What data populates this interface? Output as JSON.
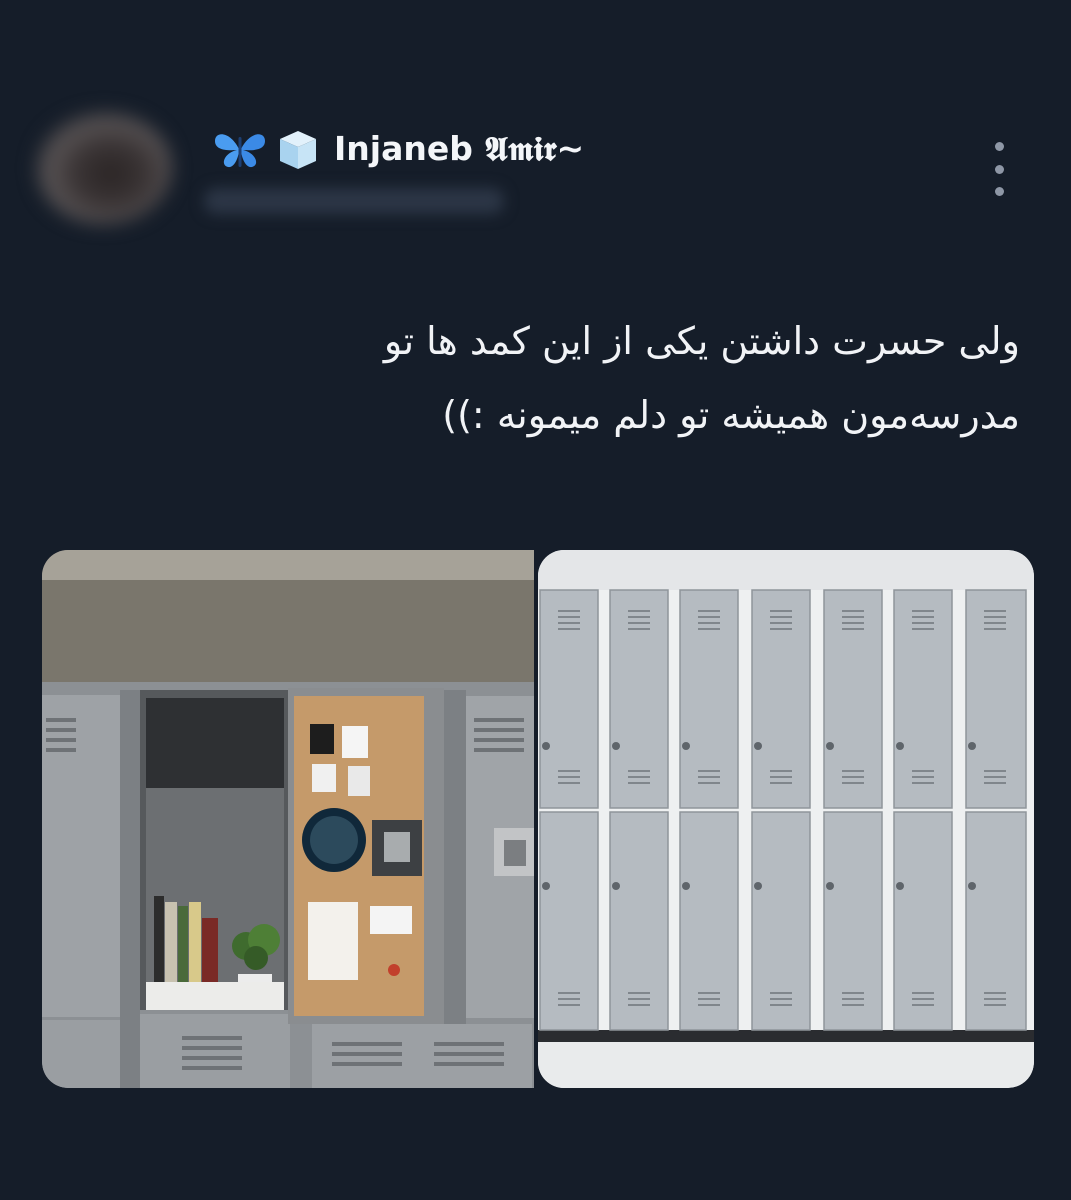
{
  "tweet": {
    "display_name": "Injaneb 𝕬𝖒𝖎𝖗~",
    "text_lines": [
      "ولی حسرت داشتن یکی از این کمد ها تو",
      "مدرسه‌مون همیشه تو دلم میمونه :))"
    ]
  },
  "icons": [
    "butterfly-emoji-icon",
    "ice-cube-emoji-icon",
    "more-options-icon"
  ],
  "media": {
    "image_count": 2
  },
  "colors": {
    "background": "#151d29",
    "text": "#f1f3f6",
    "muted": "#8e97a6"
  }
}
